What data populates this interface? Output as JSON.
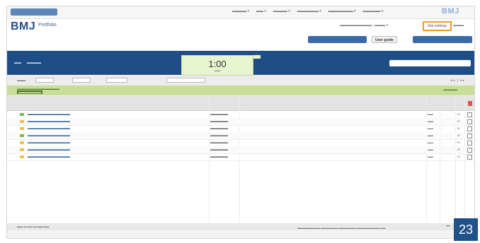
{
  "bmj_small_logo": "BMJ",
  "header": {
    "logo_bmj": "BMJ",
    "logo_product": "Portfolio",
    "site_settings": "Site settings",
    "user_guide": "User guide"
  },
  "timer": {
    "value": "1:00"
  },
  "page_number": "23",
  "colors": {
    "toolbar": "#1f4e86",
    "notice": "#c9dd9b",
    "highlight": "#f29a1d",
    "badge": "#1f5289"
  },
  "icons": {
    "folder": "folder-icon",
    "link": "link-icon",
    "trash": "trash-icon"
  },
  "rows": [
    {
      "folder_color": "#7fb84a"
    },
    {
      "folder_color": "#f0c14b"
    },
    {
      "folder_color": "#f0c14b"
    },
    {
      "folder_color": "#7fb84a"
    },
    {
      "folder_color": "#f0c14b"
    },
    {
      "folder_color": "#f0c14b"
    },
    {
      "folder_color": "#f0c14b"
    }
  ]
}
